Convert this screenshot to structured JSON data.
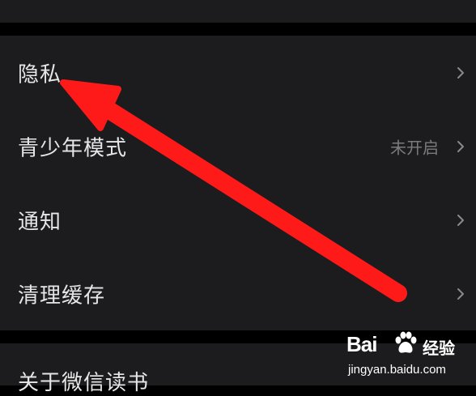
{
  "settings": {
    "items": [
      {
        "label": "隐私",
        "value": ""
      },
      {
        "label": "青少年模式",
        "value": "未开启"
      },
      {
        "label": "通知",
        "value": ""
      },
      {
        "label": "清理缓存",
        "value": ""
      }
    ],
    "bottom_item": {
      "label": "关于微信读书"
    }
  },
  "annotation": {
    "arrow_color": "#ff1a1a"
  },
  "watermark": {
    "brand": "Bai",
    "name": "经验",
    "url": "jingyan.baidu.com"
  },
  "colors": {
    "background": "#000000",
    "group": "#1c1c1e",
    "text": "#e6e6e6",
    "secondary_text": "#7b7b7f"
  },
  "icons": {
    "row_disclosure": "chevron-right-icon",
    "watermark_logo": "paw-icon"
  }
}
